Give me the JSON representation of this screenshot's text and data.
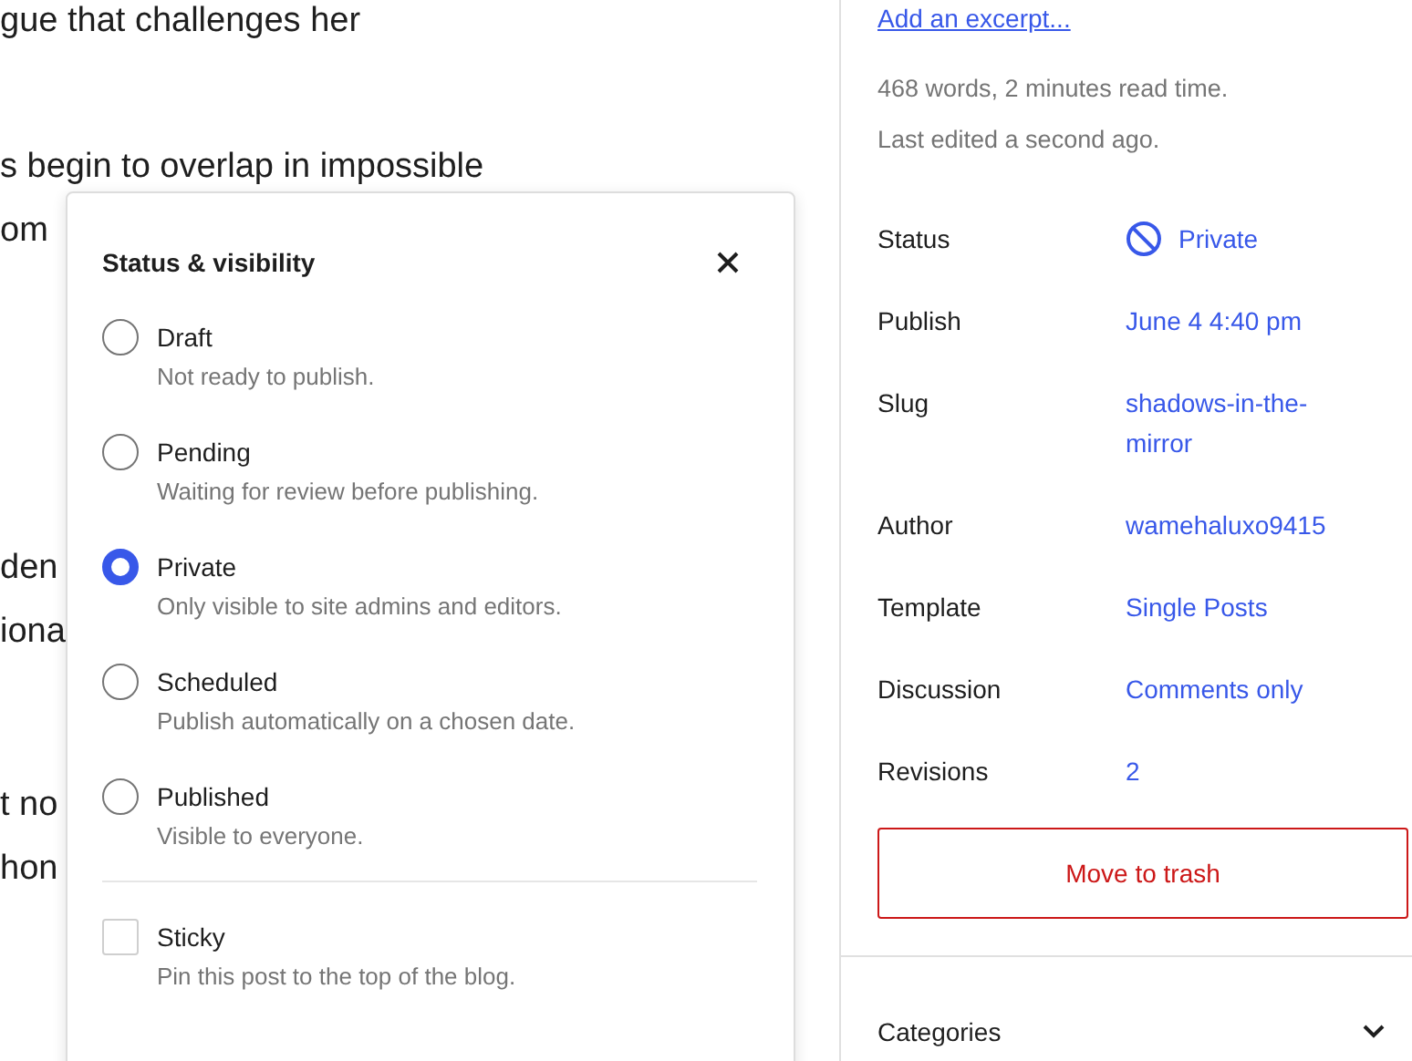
{
  "editor": {
    "paragraphs": [
      {
        "lines": [
          "gue that challenges her"
        ]
      },
      {
        "lines": [
          "s begin to overlap in impossible",
          "om"
        ]
      },
      {
        "lines": [
          "den",
          "iona"
        ]
      },
      {
        "lines": [
          "t no",
          "hon"
        ]
      }
    ]
  },
  "popover": {
    "title": "Status & visibility",
    "options": [
      {
        "label": "Draft",
        "description": "Not ready to publish.",
        "selected": false
      },
      {
        "label": "Pending",
        "description": "Waiting for review before publishing.",
        "selected": false
      },
      {
        "label": "Private",
        "description": "Only visible to site admins and editors.",
        "selected": true
      },
      {
        "label": "Scheduled",
        "description": "Publish automatically on a chosen date.",
        "selected": false
      },
      {
        "label": "Published",
        "description": "Visible to everyone.",
        "selected": false
      }
    ],
    "sticky": {
      "label": "Sticky",
      "description": "Pin this post to the top of the blog.",
      "checked": false
    }
  },
  "sidebar": {
    "excerpt_link": "Add an excerpt...",
    "stats": [
      "468 words, 2 minutes read time.",
      "Last edited a second ago."
    ],
    "rows": [
      {
        "label": "Status",
        "value": "Private",
        "kind": "status"
      },
      {
        "label": "Publish",
        "value": "June 4 4:40 pm",
        "kind": "link"
      },
      {
        "label": "Slug",
        "value": "shadows-in-the-mirror",
        "kind": "link"
      },
      {
        "label": "Author",
        "value": "wamehaluxo9415",
        "kind": "link"
      },
      {
        "label": "Template",
        "value": "Single Posts",
        "kind": "link"
      },
      {
        "label": "Discussion",
        "value": "Comments only",
        "kind": "link"
      },
      {
        "label": "Revisions",
        "value": "2",
        "kind": "link"
      }
    ],
    "trash_button": "Move to trash",
    "panel": {
      "title": "Categories",
      "expanded": false
    }
  }
}
